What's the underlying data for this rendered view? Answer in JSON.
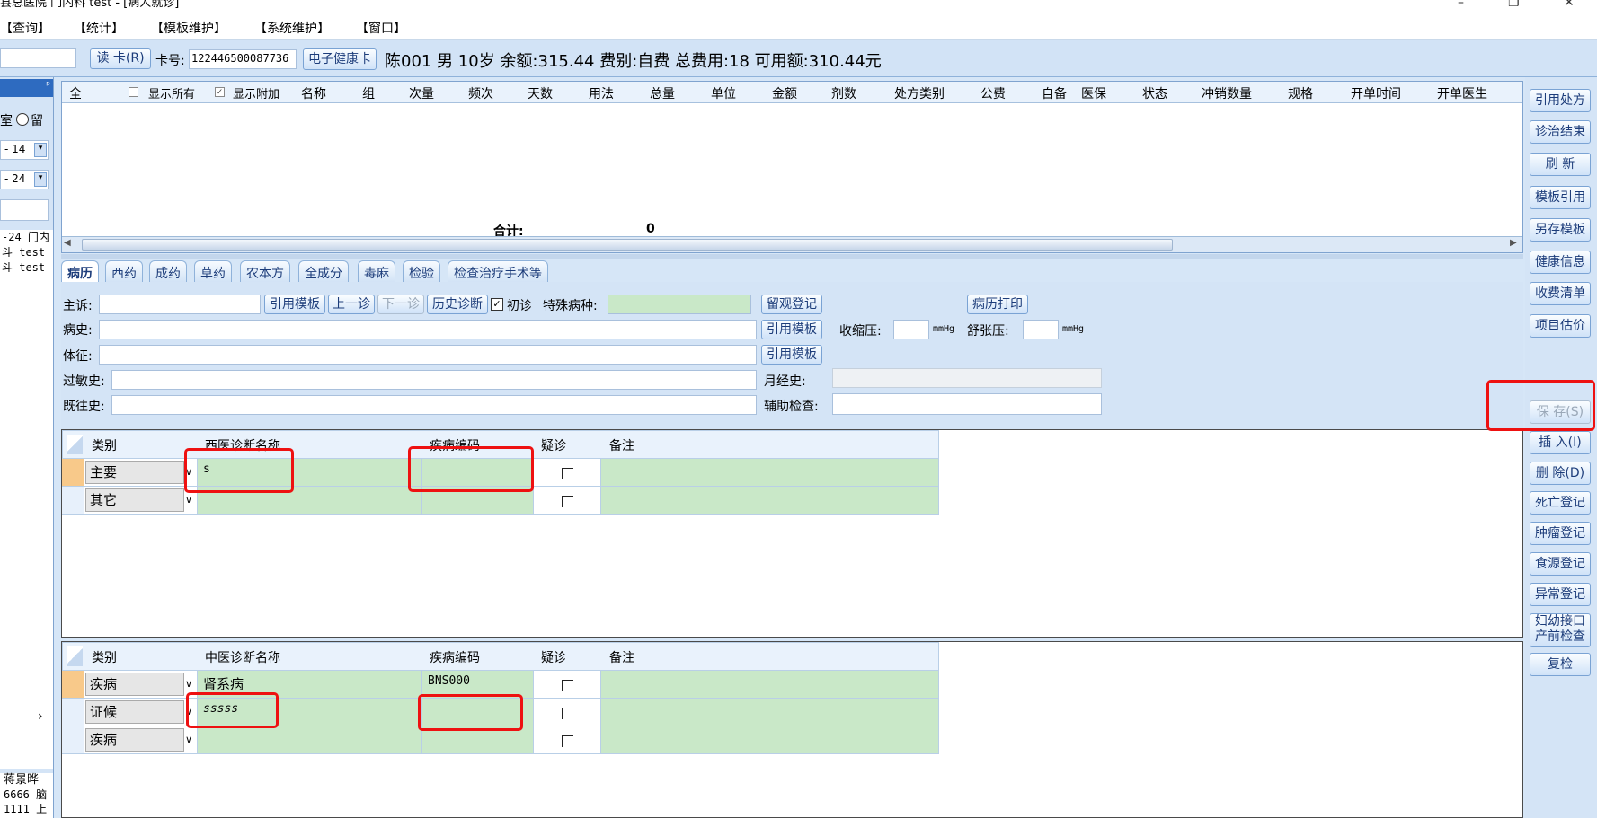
{
  "window": {
    "title": "县总医院 门内科 test - [病人就诊]",
    "minimize": "–",
    "maximize": "❐",
    "close": "✕"
  },
  "menu": [
    "【查询】",
    "【统计】",
    "【模板维护】",
    "【系统维护】",
    "【窗口】"
  ],
  "toolbar": {
    "read_card": "读 卡(R)",
    "card_no_label": "卡号:",
    "card_no_value": "122446500087736",
    "health_card": "电子健康卡",
    "patient_info": "陈001 男 10岁 余额:315.44 费别:自费 总费用:18 可用额:310.44元"
  },
  "left_panel": {
    "pin": "ᵖ",
    "radio_text": "室",
    "radio_text2": "留",
    "date1": "- 14",
    "date2": "- 24",
    "list": [
      "-24 门内",
      "斗 test",
      "斗 test"
    ],
    "scroll_arrow": "›",
    "bottom": [
      "蒋景晔",
      "6666 脑",
      "1111 上"
    ]
  },
  "rx_grid": {
    "headers": [
      "全",
      "显示所有",
      "显示附加",
      "名称",
      "组",
      "次量",
      "频次",
      "天数",
      "用法",
      "总量",
      "单位",
      "金额",
      "剂数",
      "处方类别",
      "公费",
      "自备",
      "医保",
      "状态",
      "冲销数量",
      "规格",
      "开单时间",
      "开单医生"
    ],
    "total_label": "合计:",
    "total_value": "0"
  },
  "tabs": [
    "病历",
    "西药",
    "成药",
    "草药",
    "农本方",
    "全成分",
    "毒麻",
    "检验",
    "检查治疗手术等"
  ],
  "record": {
    "complaint_label": "主诉:",
    "btn_cite_template": "引用模板",
    "btn_prev": "上一诊",
    "btn_next": "下一诊",
    "btn_history": "历史诊断",
    "first_visit": "初诊",
    "special_disease": "特殊病种:",
    "btn_observe": "留观登记",
    "btn_print": "病历打印",
    "history_label": "病史:",
    "sign_label": "体征:",
    "allergy_label": "过敏史:",
    "past_label": "既往史:",
    "systolic": "收缩压:",
    "diastolic": "舒张压:",
    "unit_mmhg": "mmHg",
    "menstrual": "月经史:",
    "aux_exam": "辅助检查:"
  },
  "western_dx": {
    "headers": [
      "类别",
      "西医诊断名称",
      "疾病编码",
      "疑诊",
      "备注"
    ],
    "rows": [
      {
        "type": "主要",
        "name": "s",
        "code": ""
      },
      {
        "type": "其它",
        "name": "",
        "code": ""
      }
    ]
  },
  "tcm_dx": {
    "headers": [
      "类别",
      "中医诊断名称",
      "疾病编码",
      "疑诊",
      "备注"
    ],
    "rows": [
      {
        "type": "疾病",
        "name": "肾系病",
        "code": "BNS000"
      },
      {
        "type": "证候",
        "name": "sssss",
        "code": ""
      },
      {
        "type": "疾病",
        "name": "",
        "code": ""
      }
    ]
  },
  "right_buttons": [
    "引用处方",
    "诊治结束",
    "刷 新",
    "模板引用",
    "另存模板",
    "健康信息",
    "收费清单",
    "项目估价",
    "保 存(S)",
    "插 入(I)",
    "删 除(D)",
    "死亡登记",
    "肿瘤登记",
    "食源登记",
    "异常登记",
    "妇幼接口",
    "产前检查",
    "复检"
  ]
}
